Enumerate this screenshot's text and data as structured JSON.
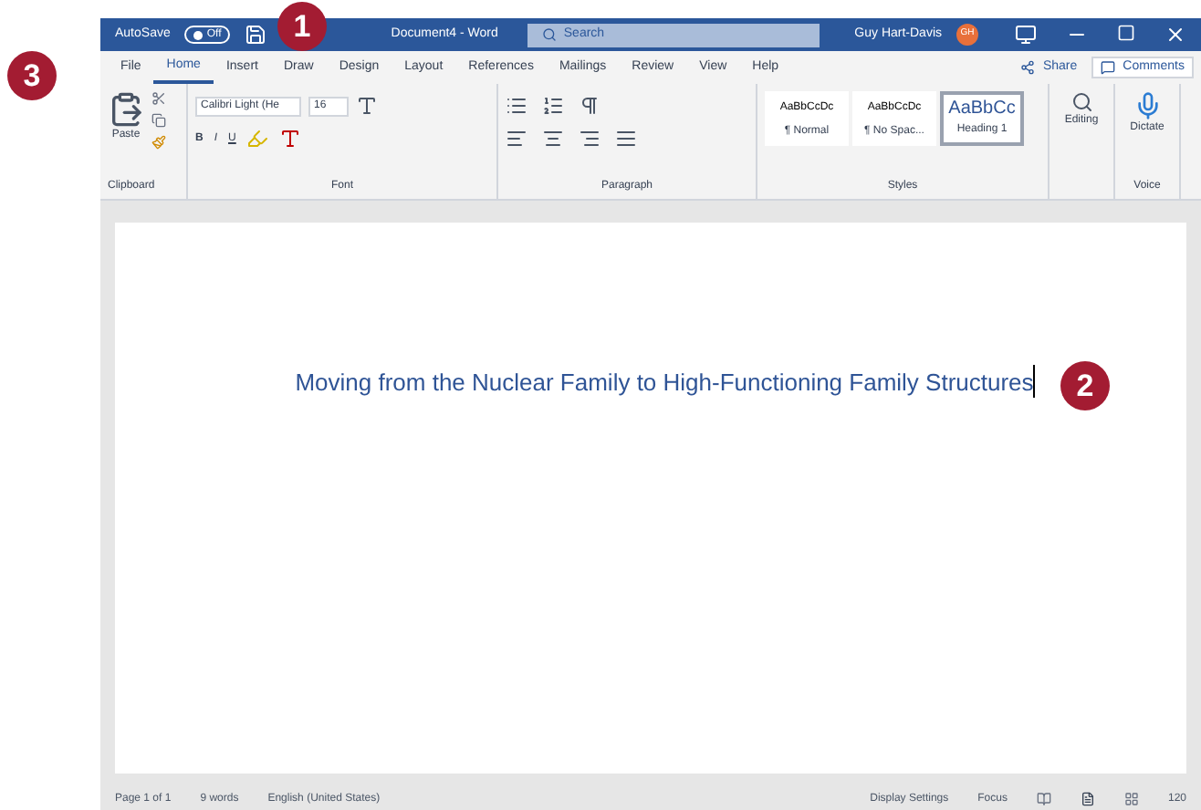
{
  "title_bar": {
    "autosave_label": "AutoSave",
    "autosave_on": false,
    "toggle_text": "Off",
    "document_title": "Document4 - Word",
    "search_placeholder": "Search",
    "user_name": "Guy Hart-Davis",
    "avatar_initials": "GH"
  },
  "tabs": [
    {
      "label": "File",
      "selected": false
    },
    {
      "label": "Home",
      "selected": true
    },
    {
      "label": "Insert",
      "selected": false
    },
    {
      "label": "Draw",
      "selected": false
    },
    {
      "label": "Design",
      "selected": false
    },
    {
      "label": "Layout",
      "selected": false
    },
    {
      "label": "References",
      "selected": false
    },
    {
      "label": "Mailings",
      "selected": false
    },
    {
      "label": "Review",
      "selected": false
    },
    {
      "label": "View",
      "selected": false
    },
    {
      "label": "Help",
      "selected": false
    }
  ],
  "share": "Share",
  "comments": "Comments",
  "ribbon": {
    "paste": "Paste",
    "font_name": "Calibri Light (He",
    "font_size": "16",
    "format_buttons": [
      "B",
      "I",
      "U"
    ],
    "styles": [
      {
        "preview": "AaBbCcDc",
        "name": "¶ Normal",
        "selected": false
      },
      {
        "preview": "AaBbCcDc",
        "name": "¶ No Spac...",
        "selected": false
      },
      {
        "preview": "AaBbCc",
        "name": "Heading 1",
        "selected": true
      }
    ],
    "editing": "Editing",
    "dictate": "Dictate",
    "groups": [
      "Clipboard",
      "Font",
      "Paragraph",
      "Styles",
      "Voice"
    ]
  },
  "document_text": "Moving from the Nuclear Family to High-Functioning Family Structures",
  "callouts": [
    "1",
    "2",
    "3"
  ],
  "status_bar": {
    "left": [
      "Page 1 of 1",
      "9 words",
      "English (United States)"
    ],
    "display_settings": "Display Settings",
    "focus": "Focus",
    "zoom": "120"
  }
}
